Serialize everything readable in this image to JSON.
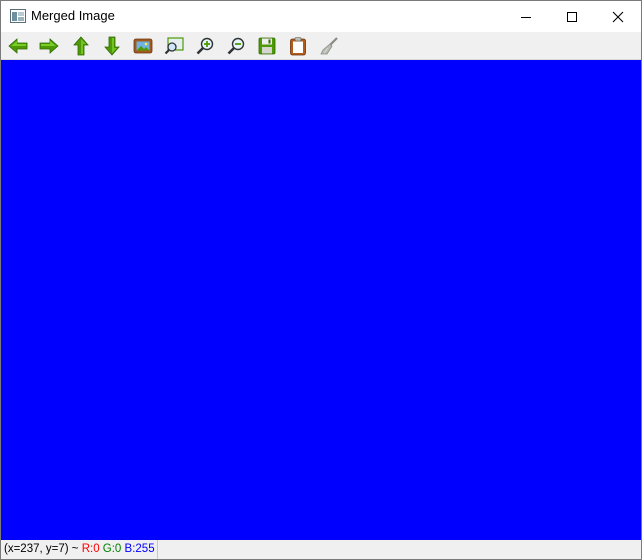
{
  "window": {
    "title": "Merged Image"
  },
  "toolbar": {
    "buttons": [
      {
        "name": "back-icon"
      },
      {
        "name": "forward-icon"
      },
      {
        "name": "up-icon"
      },
      {
        "name": "down-icon"
      },
      {
        "name": "image-icon"
      },
      {
        "name": "zoom-region-icon"
      },
      {
        "name": "zoom-in-icon"
      },
      {
        "name": "zoom-out-icon"
      },
      {
        "name": "save-icon"
      },
      {
        "name": "clipboard-icon"
      },
      {
        "name": "brush-icon"
      }
    ]
  },
  "canvas": {
    "fill_color": "#0000ff"
  },
  "status": {
    "coords": "(x=237, y=7) ~",
    "r": "R:0",
    "g": "G:0",
    "b": "B:255"
  }
}
